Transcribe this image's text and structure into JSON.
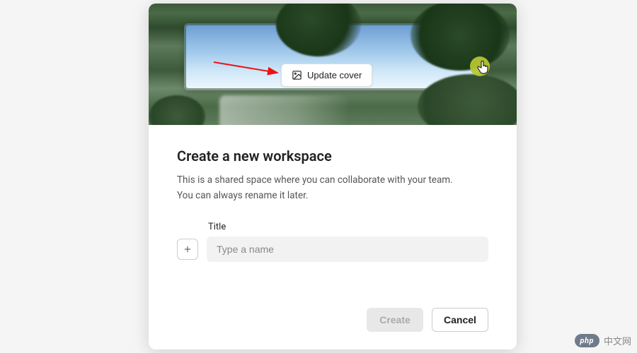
{
  "dialog": {
    "cover": {
      "update_button_label": "Update cover"
    },
    "heading": "Create a new workspace",
    "description_line1": "This is a shared space where you can collaborate with your team.",
    "description_line2": "You can always rename it later.",
    "field": {
      "label": "Title",
      "placeholder": "Type a name",
      "value": ""
    },
    "buttons": {
      "create": "Create",
      "cancel": "Cancel"
    }
  },
  "watermark": {
    "pill": "php",
    "text": "中文网"
  }
}
